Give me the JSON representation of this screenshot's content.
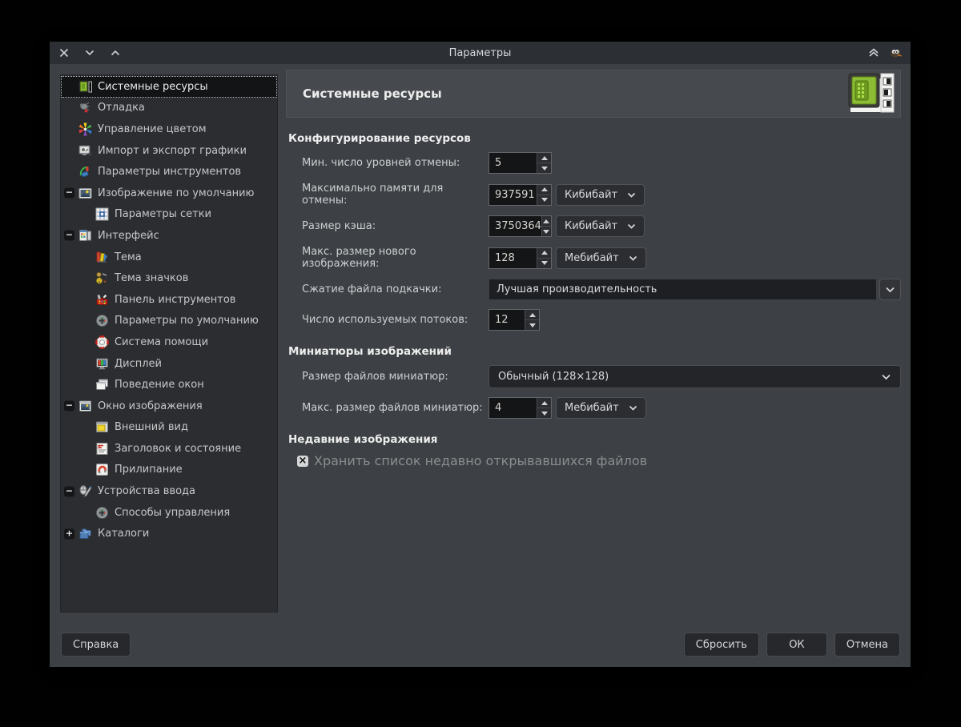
{
  "window": {
    "title": "Параметры"
  },
  "titlebar": {
    "icons": [
      "close-icon",
      "unmaximize-icon",
      "maximize-icon",
      "shade-icon",
      "gimp-wilber-icon"
    ]
  },
  "sidebar": {
    "items": [
      {
        "id": "system-resources",
        "label": "Системные ресурсы",
        "icon": "system-resources",
        "depth": 0,
        "expander": null,
        "selected": true
      },
      {
        "id": "debugging",
        "label": "Отладка",
        "icon": "debug",
        "depth": 0,
        "expander": null,
        "selected": false
      },
      {
        "id": "color-management",
        "label": "Управление цветом",
        "icon": "color-management",
        "depth": 0,
        "expander": null,
        "selected": false
      },
      {
        "id": "image-import-export",
        "label": "Импорт и экспорт графики",
        "icon": "import-export",
        "depth": 0,
        "expander": null,
        "selected": false
      },
      {
        "id": "tool-options",
        "label": "Параметры инструментов",
        "icon": "tool-options",
        "depth": 0,
        "expander": null,
        "selected": false
      },
      {
        "id": "default-image",
        "label": "Изображение по умолчанию",
        "icon": "default-image",
        "depth": 0,
        "expander": "minus",
        "selected": false
      },
      {
        "id": "default-grid",
        "label": "Параметры сетки",
        "icon": "grid",
        "depth": 1,
        "expander": null,
        "selected": false
      },
      {
        "id": "interface",
        "label": "Интерфейс",
        "icon": "interface",
        "depth": 0,
        "expander": "minus",
        "selected": false
      },
      {
        "id": "theme",
        "label": "Тема",
        "icon": "theme",
        "depth": 1,
        "expander": null,
        "selected": false
      },
      {
        "id": "icon-theme",
        "label": "Тема значков",
        "icon": "icon-theme",
        "depth": 1,
        "expander": null,
        "selected": false
      },
      {
        "id": "toolbox",
        "label": "Панель инструментов",
        "icon": "toolbox",
        "depth": 1,
        "expander": null,
        "selected": false
      },
      {
        "id": "dialog-defaults",
        "label": "Параметры по умолчанию",
        "icon": "controllers",
        "depth": 1,
        "expander": null,
        "selected": false
      },
      {
        "id": "help-system",
        "label": "Система помощи",
        "icon": "help",
        "depth": 1,
        "expander": null,
        "selected": false
      },
      {
        "id": "display",
        "label": "Дисплей",
        "icon": "display",
        "depth": 1,
        "expander": null,
        "selected": false
      },
      {
        "id": "window-management",
        "label": "Поведение окон",
        "icon": "window-management",
        "depth": 1,
        "expander": null,
        "selected": false
      },
      {
        "id": "image-window",
        "label": "Окно изображения",
        "icon": "image-window",
        "depth": 0,
        "expander": "minus",
        "selected": false
      },
      {
        "id": "appearance",
        "label": "Внешний вид",
        "icon": "appearance",
        "depth": 1,
        "expander": null,
        "selected": false
      },
      {
        "id": "title-status",
        "label": "Заголовок и состояние",
        "icon": "title-status",
        "depth": 1,
        "expander": null,
        "selected": false
      },
      {
        "id": "snapping",
        "label": "Прилипание",
        "icon": "snapping",
        "depth": 1,
        "expander": null,
        "selected": false
      },
      {
        "id": "input-devices",
        "label": "Устройства ввода",
        "icon": "input-devices",
        "depth": 0,
        "expander": "minus",
        "selected": false
      },
      {
        "id": "input-controllers",
        "label": "Способы управления",
        "icon": "controllers",
        "depth": 1,
        "expander": null,
        "selected": false
      },
      {
        "id": "folders",
        "label": "Каталоги",
        "icon": "folders",
        "depth": 0,
        "expander": "plus",
        "selected": false
      }
    ]
  },
  "page": {
    "title": "Системные ресурсы",
    "header_icon": "system-resources-large-icon"
  },
  "form": {
    "section_resources": "Конфигурирование ресурсов",
    "min_undo": {
      "label": "Мин. число уровней отмены:",
      "value": "5"
    },
    "max_undo_mem": {
      "label": "Максимально памяти для отмены:",
      "value": "937591",
      "unit": "Кибибайт"
    },
    "cache_size": {
      "label": "Размер кэша:",
      "value": "3750364",
      "unit": "Кибибайт"
    },
    "max_new_image": {
      "label": "Макс. размер нового изображения:",
      "value": "128",
      "unit": "Мебибайт"
    },
    "swap_compression": {
      "label": "Сжатие файла подкачки:",
      "value": "Лучшая производительность"
    },
    "num_threads": {
      "label": "Число используемых потоков:",
      "value": "12"
    },
    "section_thumbnails": "Миниатюры изображений",
    "thumb_size": {
      "label": "Размер файлов миниатюр:",
      "value": "Обычный (128×128)"
    },
    "thumb_max_filesize": {
      "label": "Макс. размер файлов миниатюр:",
      "value": "4",
      "unit": "Мебибайт"
    },
    "section_recent": "Недавние изображения",
    "keep_recent": {
      "label": "Хранить список недавно открывавшихся файлов",
      "checked": true
    }
  },
  "footer": {
    "help": "Справка",
    "reset": "Сбросить",
    "ok": "ОК",
    "cancel": "Отмена"
  },
  "colors": {
    "accent_green": "#8cbc35",
    "panel": "#3d4044",
    "sidebar": "#2c2d30",
    "titlebar": "#2c2f34"
  }
}
